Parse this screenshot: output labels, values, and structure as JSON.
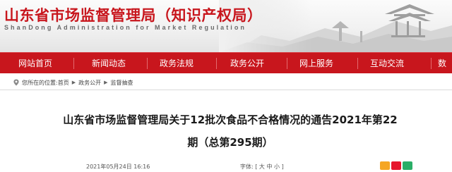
{
  "header": {
    "title": "山东省市场监督管理局（知识产权局）",
    "subtitle": "ShanDong Administration for Market Regulation"
  },
  "nav": {
    "items": [
      {
        "label": "网站首页"
      },
      {
        "label": "新闻动态"
      },
      {
        "label": "政务法规"
      },
      {
        "label": "政务公开"
      },
      {
        "label": "网上服务"
      },
      {
        "label": "互动交流"
      },
      {
        "label": "数"
      }
    ]
  },
  "breadcrumb": {
    "prefix": "您所在的位置:",
    "items": [
      "首页",
      "政务公开",
      "监督抽查"
    ],
    "icon": "location-icon"
  },
  "article": {
    "title": "山东省市场监督管理局关于12批次食品不合格情况的通告2021年第22期（总第295期）",
    "date": "2021年05月24日 16:16",
    "font_size_label": "字体:",
    "font_sizes": [
      "大",
      "中",
      "小"
    ],
    "bracket_open": "[",
    "bracket_close": "]"
  },
  "colors": {
    "brand_red": "#c8161d",
    "nav_text": "#ffffff",
    "title_text": "#1a1a1a"
  }
}
